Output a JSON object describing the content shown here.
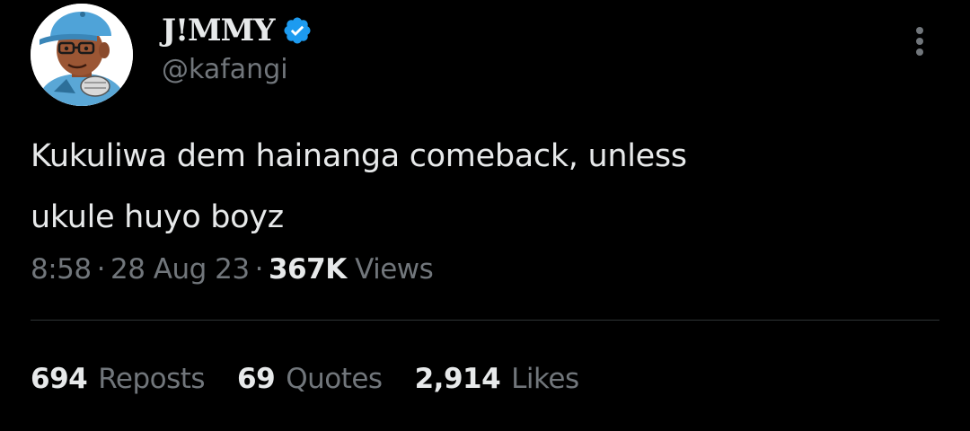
{
  "user": {
    "display_name": "J!MMY",
    "handle": "@kafangi",
    "verified_color": "#1d9bf0"
  },
  "tweet": {
    "text_lines": [
      "Kukuliwa dem hainanga comeback, unless",
      "ukule huyo boyz"
    ],
    "time": "8:58",
    "date": "28 Aug 23",
    "views_count": "367K",
    "views_label": "Views"
  },
  "stats": {
    "reposts": {
      "count": "694",
      "label": "Reposts"
    },
    "quotes": {
      "count": "69",
      "label": "Quotes"
    },
    "likes": {
      "count": "2,914",
      "label": "Likes"
    }
  },
  "icons": {
    "more": "more-vertical-icon",
    "verified": "verified-badge-icon"
  },
  "colors": {
    "background": "#000000",
    "primary_text": "#e7e9ea",
    "secondary_text": "#71767b",
    "divider": "#2f3336",
    "accent": "#1d9bf0"
  }
}
